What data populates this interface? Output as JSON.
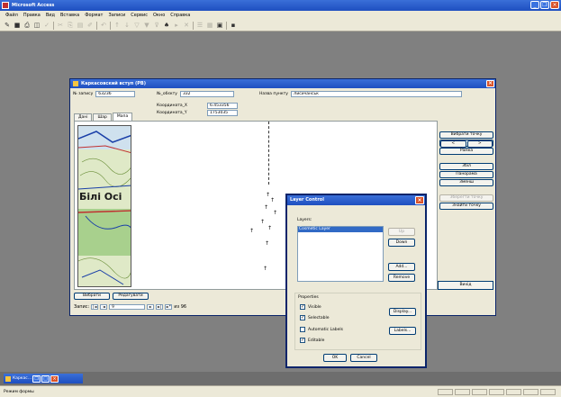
{
  "app": {
    "title": "Microsoft Access",
    "menu": [
      "Файл",
      "Правка",
      "Вид",
      "Вставка",
      "Формат",
      "Записи",
      "Сервис",
      "Окно",
      "Справка"
    ]
  },
  "form": {
    "title": "Каркасовский вступ (РВ)",
    "fields": {
      "n_label": "№ запису",
      "n_value": "63236",
      "obj_label": "№_обєкту",
      "obj_value": "332",
      "name_label": "Назва пункту",
      "name_value": "Лисичанськ",
      "coord_x_label": "Координата_X",
      "coord_x_value": "6.453356",
      "coord_y_label": "Координата_Y",
      "coord_y_value": "1753035"
    },
    "tabs": [
      "Дані",
      "Шар",
      "Мапа"
    ],
    "active_tab": 2,
    "right_buttons": {
      "choose": "Вибрати точку",
      "prev": "<",
      "next": ">",
      "frame": "Рамка",
      "zoom_in": "Збіл",
      "pan": "Панорама",
      "zoom_out": "Зменш",
      "save_point": "Зберегти точку",
      "view_point": "Знайти точку",
      "exit": "Вихід"
    },
    "bottom_buttons": {
      "choose": "Вибрати",
      "edit": "Редагувати"
    },
    "nav": {
      "record_label": "Запис:",
      "first": "|◄",
      "prev": "◄",
      "current": "9",
      "next": "►",
      "last": "►|",
      "new": "►*",
      "total": "из 96"
    },
    "map_text": "Білі Осі"
  },
  "dialog": {
    "title": "Layer Control",
    "layers_label": "Layers:",
    "selected_layer": "Cosmetic Layer",
    "buttons": {
      "up": "Up",
      "down": "Down",
      "add": "Add...",
      "remove": "Remove",
      "display": "Display...",
      "labels": "Labels...",
      "ok": "OK",
      "cancel": "Cancel"
    },
    "properties_label": "Properties",
    "checks": {
      "visible": "Visible",
      "selectable": "Selectable",
      "auto_label": "Automatic Labels",
      "editable": "Editable"
    }
  },
  "taskbar": {
    "item": "Каркас..."
  },
  "status": {
    "text": "Режим формы"
  }
}
